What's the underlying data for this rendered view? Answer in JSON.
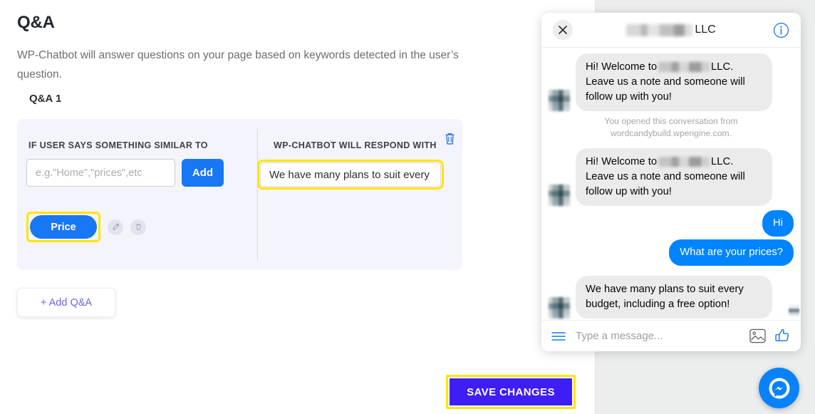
{
  "page": {
    "title": "Q&A",
    "description": "WP-Chatbot will answer questions on your page based on keywords detected in the user’s question."
  },
  "qa": {
    "group_label": "Q&A 1",
    "left_heading": "IF USER SAYS SOMETHING SIMILAR TO",
    "right_heading": "WP-CHATBOT WILL RESPOND WITH",
    "keyword_input_value": "",
    "keyword_input_placeholder": "e.g.\"Home\",\"prices\",etc",
    "add_label": "Add",
    "tags": [
      {
        "label": "Price",
        "edit_icon": "pencil-icon",
        "delete_icon": "trash-icon"
      }
    ],
    "response_value": "We have many plans to suit every budget, including a free option!",
    "delete_group_icon": "trash-icon"
  },
  "actions": {
    "add_qa_label": "+ Add Q&A",
    "save_label": "SAVE CHANGES"
  },
  "chat": {
    "header": {
      "close_icon": "close-icon",
      "title_blurred": true,
      "title_suffix": "LLC",
      "info_icon": "info-icon"
    },
    "messages": [
      {
        "from": "them",
        "avatar": "blurred-avatar",
        "text_before": "Hi! Welcome to",
        "blurred": true,
        "text_after": "LLC. Leave us a note and someone will follow up with you!"
      },
      {
        "from": "system",
        "text": "You opened this conversation from wordcandybuild.wpengine.com."
      },
      {
        "from": "them",
        "avatar": "blurred-avatar",
        "text_before": "Hi! Welcome to",
        "blurred": true,
        "text_after": "LLC. Leave us a note and someone will follow up with you!"
      },
      {
        "from": "me",
        "text": "Hi"
      },
      {
        "from": "me",
        "text": "What are your prices?"
      },
      {
        "from": "them",
        "avatar": "blurred-avatar",
        "text_before": "We have many plans to suit every budget, including a free option!",
        "blurred": false,
        "text_after": ""
      }
    ],
    "composer": {
      "menu_icon": "hamburger-icon",
      "placeholder": "Type a message...",
      "value": "",
      "image_icon": "image-icon",
      "like_icon": "thumbs-up-icon"
    }
  },
  "fab": {
    "icon": "messenger-icon"
  },
  "colors": {
    "accent_blue": "#1877f2",
    "messenger_blue": "#0084ff",
    "save_purple": "#3d1ef5",
    "highlight_yellow": "#ffe500",
    "card_lavender": "#f4f4fd",
    "panel_grey": "#eceded"
  }
}
